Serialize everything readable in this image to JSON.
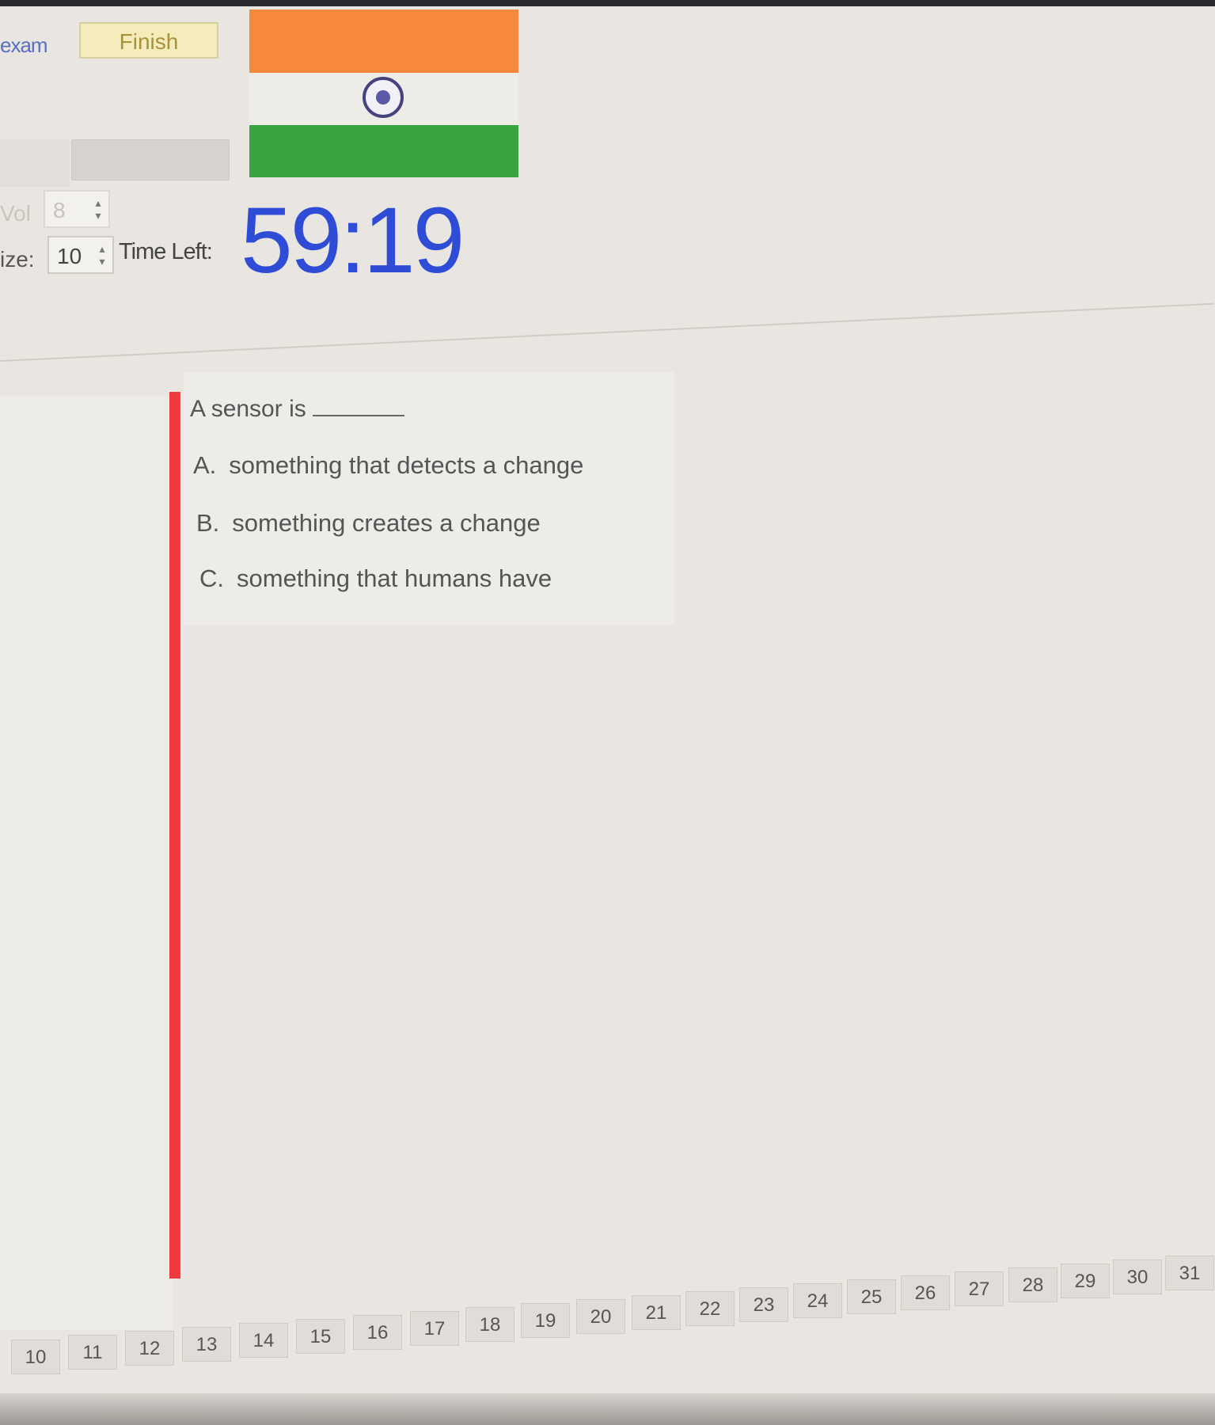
{
  "toolbar": {
    "exam_label": "exam",
    "finish_label": "Finish"
  },
  "settings": {
    "vol_label": "Vol",
    "vol_value": "8",
    "size_label": "ize:",
    "size_value": "10",
    "time_left_label": "Time Left:"
  },
  "timer": {
    "value": "59:19",
    "color": "#2f4cd6"
  },
  "flag": {
    "colors": [
      "#f6893a",
      "#eeece6",
      "#3aa442"
    ],
    "emblem": "ashoka-chakra-icon"
  },
  "question": {
    "text": "A sensor is",
    "options": [
      {
        "letter": "A.",
        "text": "something that detects a change"
      },
      {
        "letter": "B.",
        "text": "something creates a change"
      },
      {
        "letter": "C.",
        "text": "something that humans have"
      }
    ]
  },
  "navigator": {
    "pages": [
      "10",
      "11",
      "12",
      "13",
      "14",
      "15",
      "16",
      "17",
      "18",
      "19",
      "20",
      "21",
      "22",
      "23",
      "24",
      "25",
      "26",
      "27",
      "28",
      "29",
      "30",
      "31"
    ]
  },
  "accent": {
    "current_question_bar": "#ef3a3f"
  }
}
